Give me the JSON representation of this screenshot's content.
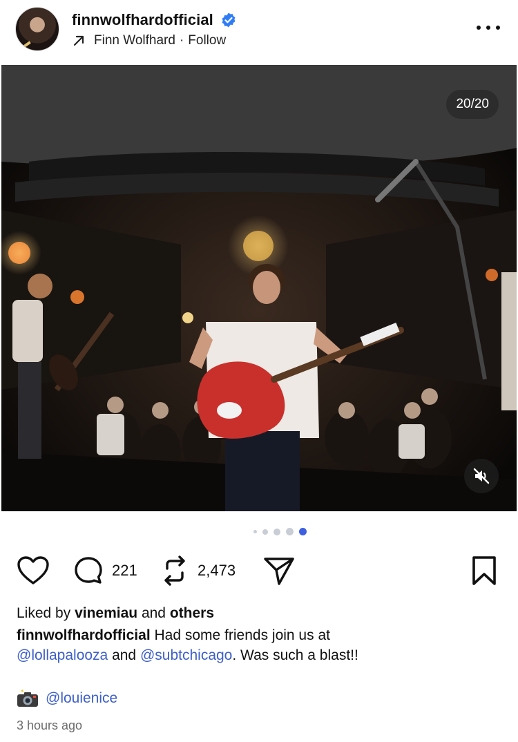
{
  "header": {
    "username": "finnwolfhardofficial",
    "repost_name": "Finn Wolfhard",
    "separator": "·",
    "follow_label": "Follow"
  },
  "media": {
    "counter": "20/20",
    "icons": {
      "mute": "speaker-muted-icon"
    },
    "carousel": {
      "total_dots": 5,
      "active_index": 4
    }
  },
  "actions": {
    "comments": "221",
    "reposts": "2,473",
    "icons": [
      "heart-icon",
      "comment-icon",
      "repost-icon",
      "share-icon",
      "bookmark-icon"
    ]
  },
  "liked": {
    "prefix": "Liked by",
    "user": "vinemiau",
    "middle": "and",
    "suffix": "others"
  },
  "caption": {
    "username": "finnwolfhardofficial",
    "text1": "Had some friends join us at",
    "mention1": "@lollapalooza",
    "text2": "and",
    "mention2": "@subtchicago",
    "text3": ". Was such a blast!!"
  },
  "credit": {
    "icon": "camera-flash-emoji",
    "mention": "@louienice"
  },
  "timestamp": "3 hours ago",
  "colors": {
    "link": "#3d5fc7",
    "verified": "#2f7df6",
    "active_dot": "#3d5fe0"
  }
}
